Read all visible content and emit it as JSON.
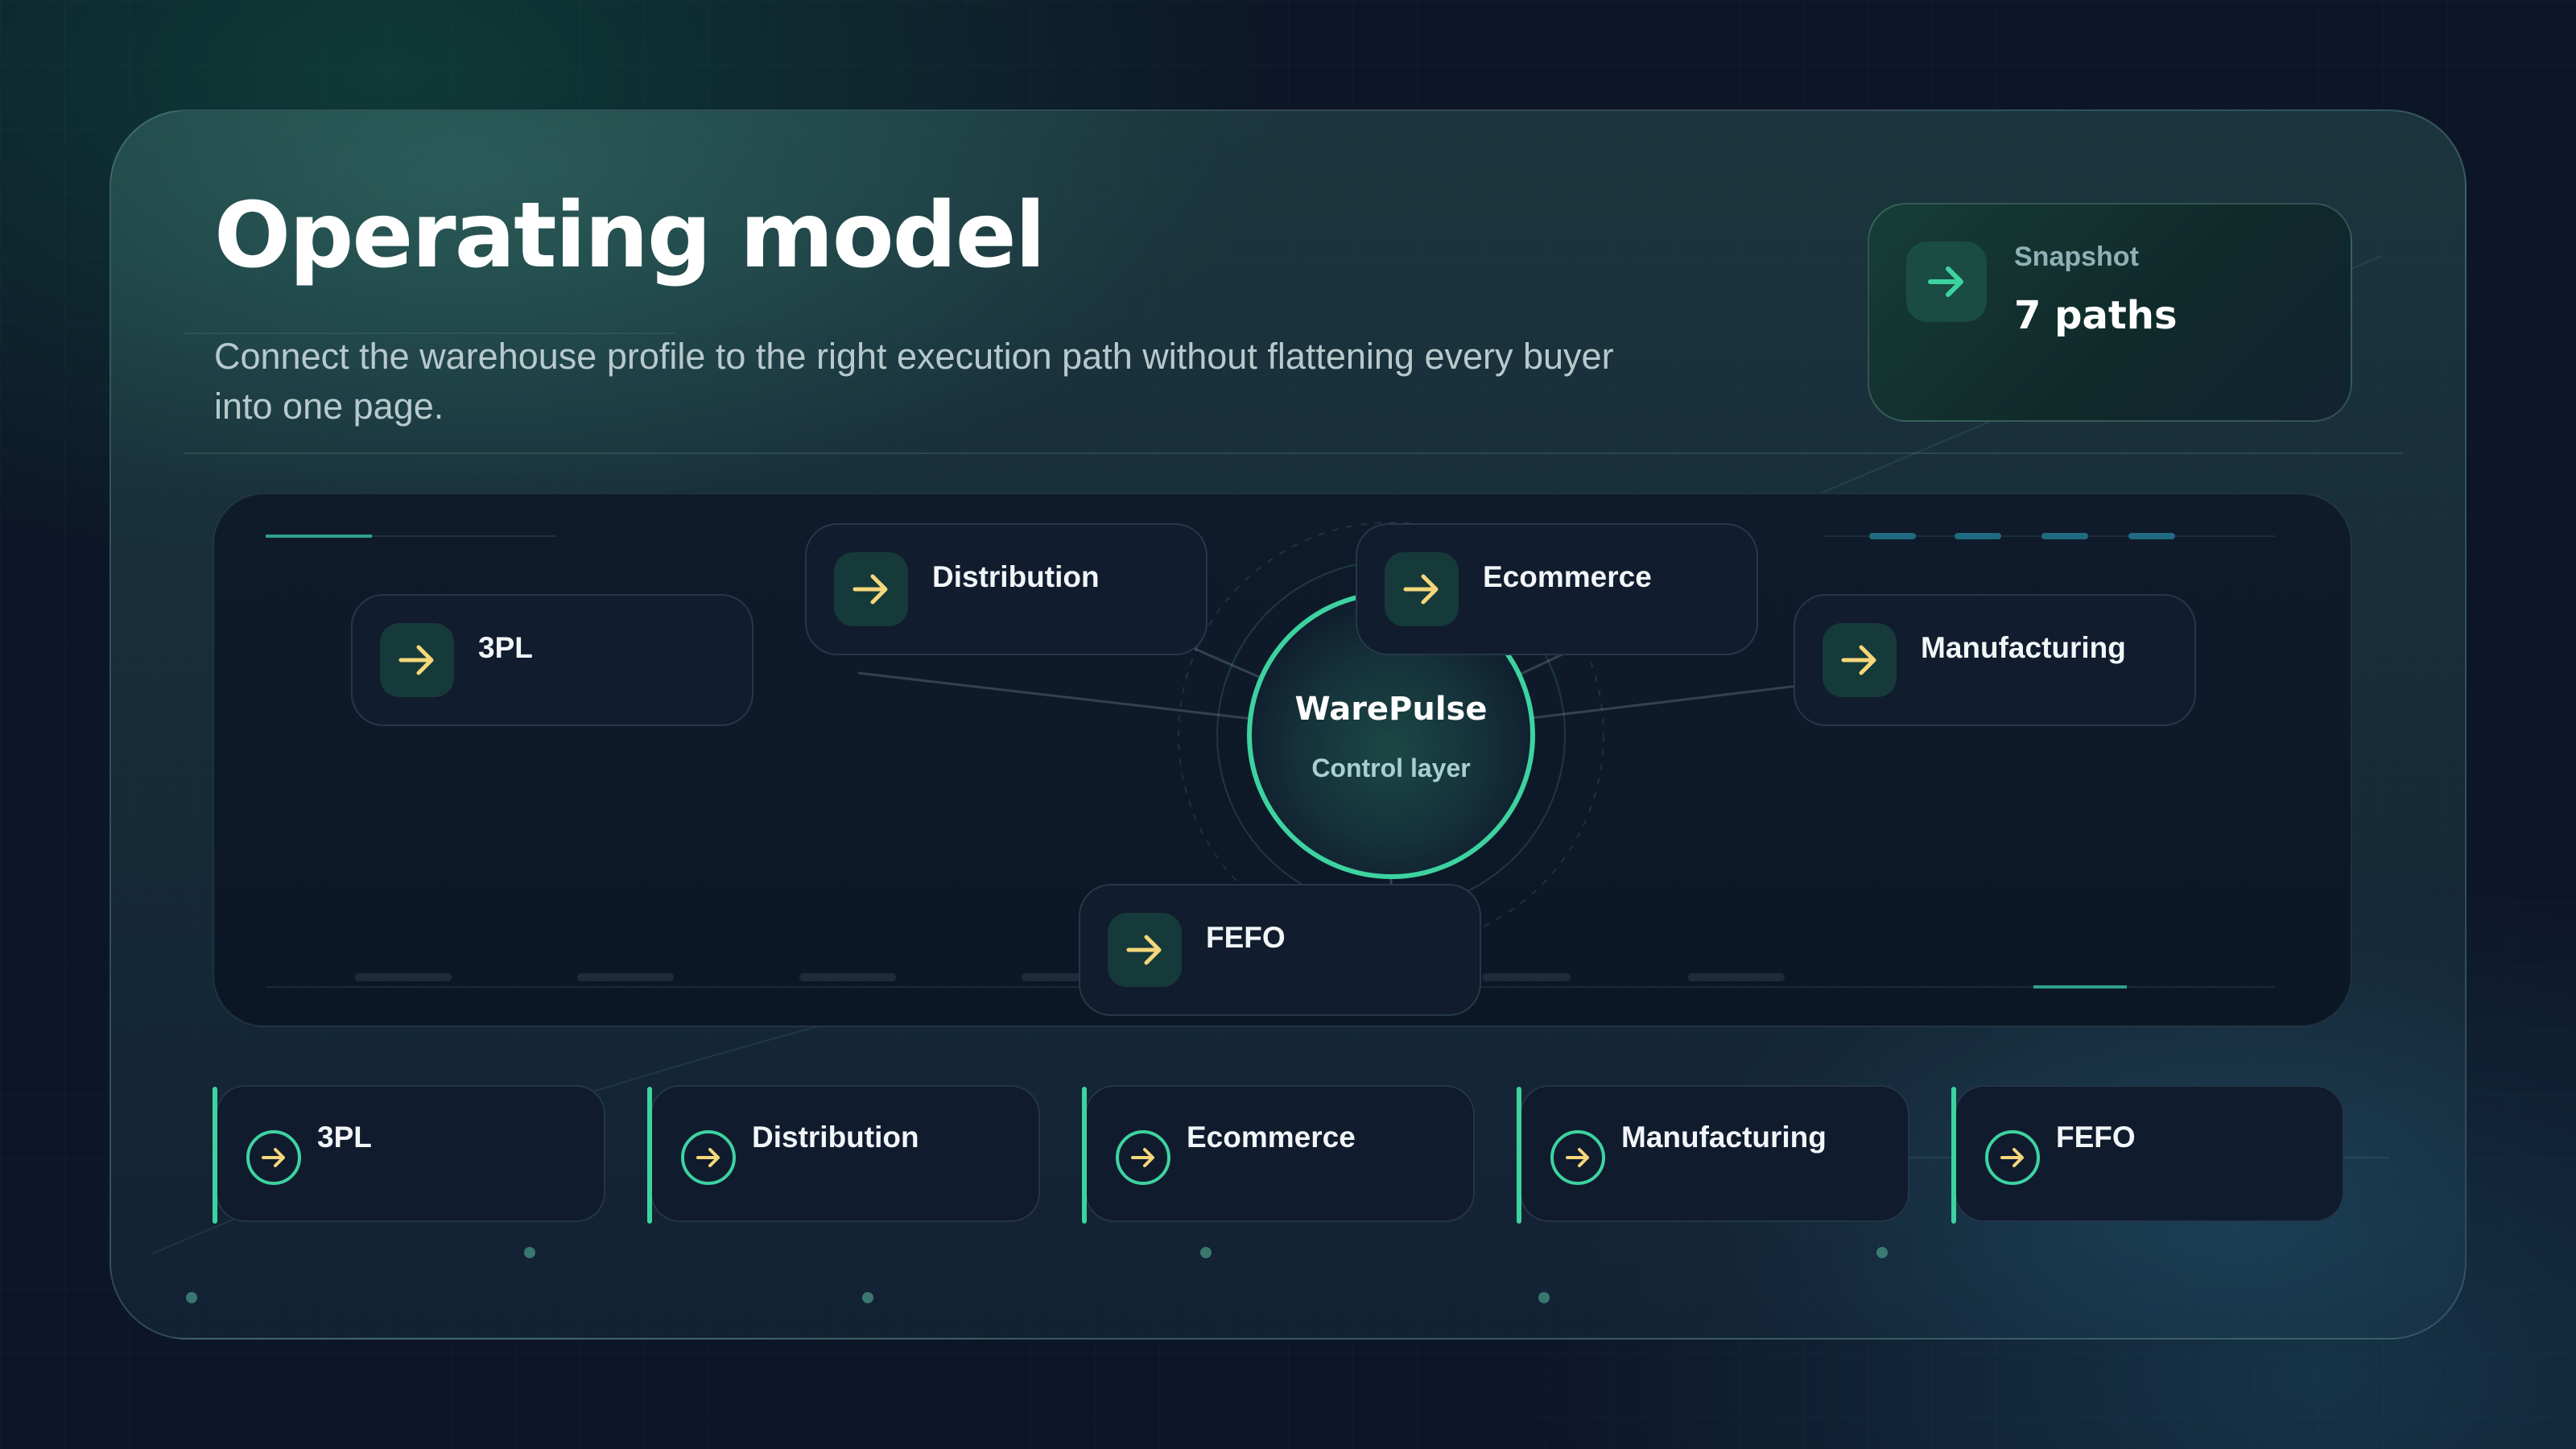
{
  "header": {
    "title": "Operating model",
    "subtitle": "Connect the warehouse profile to the right execution path without flattening every buyer into one page."
  },
  "snapshot": {
    "label": "Snapshot",
    "value": "7 paths",
    "icon": "arrow-right-icon"
  },
  "hub": {
    "title": "WarePulse",
    "subtitle": "Control layer"
  },
  "nodes": [
    {
      "label": "3PL",
      "icon": "arrow-right-icon"
    },
    {
      "label": "Distribution",
      "icon": "arrow-right-icon"
    },
    {
      "label": "Ecommerce",
      "icon": "arrow-right-icon"
    },
    {
      "label": "Manufacturing",
      "icon": "arrow-right-icon"
    },
    {
      "label": "FEFO",
      "icon": "arrow-right-icon"
    }
  ],
  "tiles": [
    {
      "label": "3PL",
      "icon": "arrow-circle-icon"
    },
    {
      "label": "Distribution",
      "icon": "arrow-circle-icon"
    },
    {
      "label": "Ecommerce",
      "icon": "arrow-circle-icon"
    },
    {
      "label": "Manufacturing",
      "icon": "arrow-circle-icon"
    },
    {
      "label": "FEFO",
      "icon": "arrow-circle-icon"
    }
  ],
  "colors": {
    "accent": "#3dd3a0",
    "arrow": "#f5d77a",
    "background": "#0d1628"
  }
}
